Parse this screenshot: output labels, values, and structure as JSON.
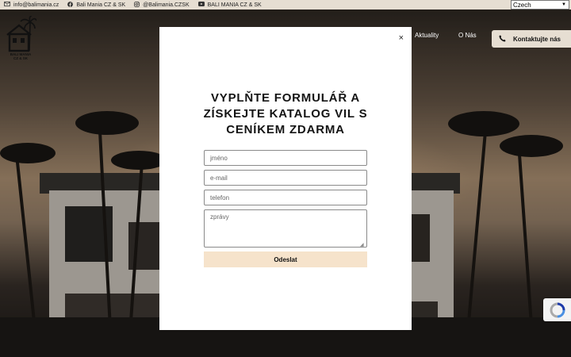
{
  "topbar": {
    "email": "info@balimania.cz",
    "facebook": "Bali Mania CZ & SK",
    "instagram": "@Balimania.CZSK",
    "youtube": "BALI MANIA CZ & SK"
  },
  "language": {
    "selected": "Czech"
  },
  "logo": {
    "line1": "BALI MANIA",
    "line2": "CZ & SK"
  },
  "nav": {
    "items": [
      "Aktuality",
      "O Nás"
    ]
  },
  "header": {
    "contact_label": "Kontaktujte nás"
  },
  "modal": {
    "title": "VYPLŇTE FORMULÁŘ A ZÍSKEJTE KATALOG VIL S CENÍKEM ZDARMA",
    "close_symbol": "×",
    "fields": {
      "name_placeholder": "jméno",
      "email_placeholder": "e-mail",
      "phone_placeholder": "telefon",
      "message_placeholder": "zprávy"
    },
    "submit_label": "Odeslat"
  },
  "icons": {
    "mail": "mail-icon",
    "facebook": "facebook-icon",
    "instagram": "instagram-icon",
    "youtube": "youtube-icon",
    "phone": "phone-icon",
    "close": "close-icon",
    "recaptcha": "recaptcha-icon"
  },
  "colors": {
    "beige": "#e6ded2",
    "submit": "#f6e3cb",
    "modal_bg": "#ffffff"
  }
}
